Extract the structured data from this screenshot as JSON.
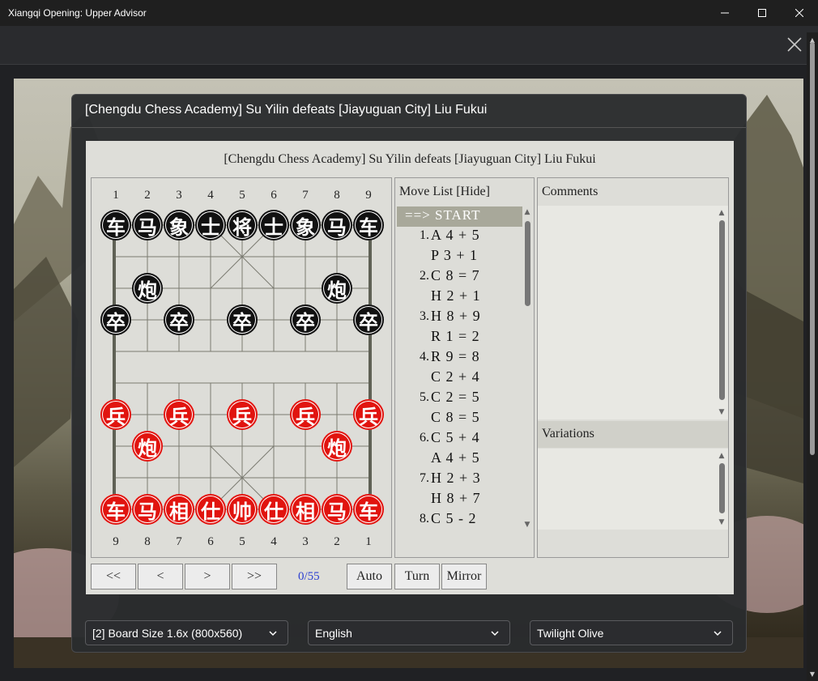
{
  "window": {
    "title": "Xiangqi Opening: Upper Advisor"
  },
  "dialog": {
    "title": "[Chengdu Chess Academy] Su Yilin defeats [Jiayuguan City] Liu Fukui"
  },
  "game": {
    "title": "[Chengdu Chess Academy] Su Yilin defeats [Jiayuguan City] Liu Fukui"
  },
  "board": {
    "top_files": [
      "1",
      "2",
      "3",
      "4",
      "5",
      "6",
      "7",
      "8",
      "9"
    ],
    "bottom_files": [
      "9",
      "8",
      "7",
      "6",
      "5",
      "4",
      "3",
      "2",
      "1"
    ],
    "black_pieces": [
      {
        "label": "车"
      },
      {
        "label": "马"
      },
      {
        "label": "象"
      },
      {
        "label": "士"
      },
      {
        "label": "将"
      },
      {
        "label": "士"
      },
      {
        "label": "象"
      },
      {
        "label": "马"
      },
      {
        "label": "车"
      },
      {
        "label": "炮"
      },
      {
        "label": "炮"
      },
      {
        "label": "卒"
      },
      {
        "label": "卒"
      },
      {
        "label": "卒"
      },
      {
        "label": "卒"
      },
      {
        "label": "卒"
      }
    ],
    "red_pieces": [
      {
        "label": "兵"
      },
      {
        "label": "兵"
      },
      {
        "label": "兵"
      },
      {
        "label": "兵"
      },
      {
        "label": "兵"
      },
      {
        "label": "炮"
      },
      {
        "label": "炮"
      },
      {
        "label": "车"
      },
      {
        "label": "马"
      },
      {
        "label": "相"
      },
      {
        "label": "仕"
      },
      {
        "label": "帅"
      },
      {
        "label": "仕"
      },
      {
        "label": "相"
      },
      {
        "label": "马"
      },
      {
        "label": "车"
      }
    ]
  },
  "moves": {
    "header": "Move List [Hide]",
    "start_label": "==> START",
    "rows": [
      {
        "num": "1.",
        "move": "A 4 + 5"
      },
      {
        "num": "",
        "move": "P 3 + 1"
      },
      {
        "num": "2.",
        "move": "C 8 = 7"
      },
      {
        "num": "",
        "move": "H 2 + 1"
      },
      {
        "num": "3.",
        "move": "H 8 + 9"
      },
      {
        "num": "",
        "move": "R 1 = 2"
      },
      {
        "num": "4.",
        "move": "R 9 = 8"
      },
      {
        "num": "",
        "move": "C 2 + 4"
      },
      {
        "num": "5.",
        "move": "C 2 = 5"
      },
      {
        "num": "",
        "move": "C 8 = 5"
      },
      {
        "num": "6.",
        "move": "C 5 + 4"
      },
      {
        "num": "",
        "move": "A 4 + 5"
      },
      {
        "num": "7.",
        "move": "H 2 + 3"
      },
      {
        "num": "",
        "move": "H 8 + 7"
      },
      {
        "num": "8.",
        "move": "C 5 - 2"
      }
    ]
  },
  "comments": {
    "header": "Comments"
  },
  "variations": {
    "header": "Variations"
  },
  "nav": {
    "first": "<<",
    "prev": "<",
    "next": ">",
    "last": ">>",
    "counter": "0/55",
    "auto": "Auto",
    "turn": "Turn",
    "mirror": "Mirror"
  },
  "settings": {
    "board_size": "[2] Board Size 1.6x (800x560)",
    "language": "English",
    "theme": "Twilight Olive"
  },
  "colors": {
    "red_piece": "#e1140f",
    "black_piece": "#111111",
    "counter_blue": "#2b3fd1"
  }
}
